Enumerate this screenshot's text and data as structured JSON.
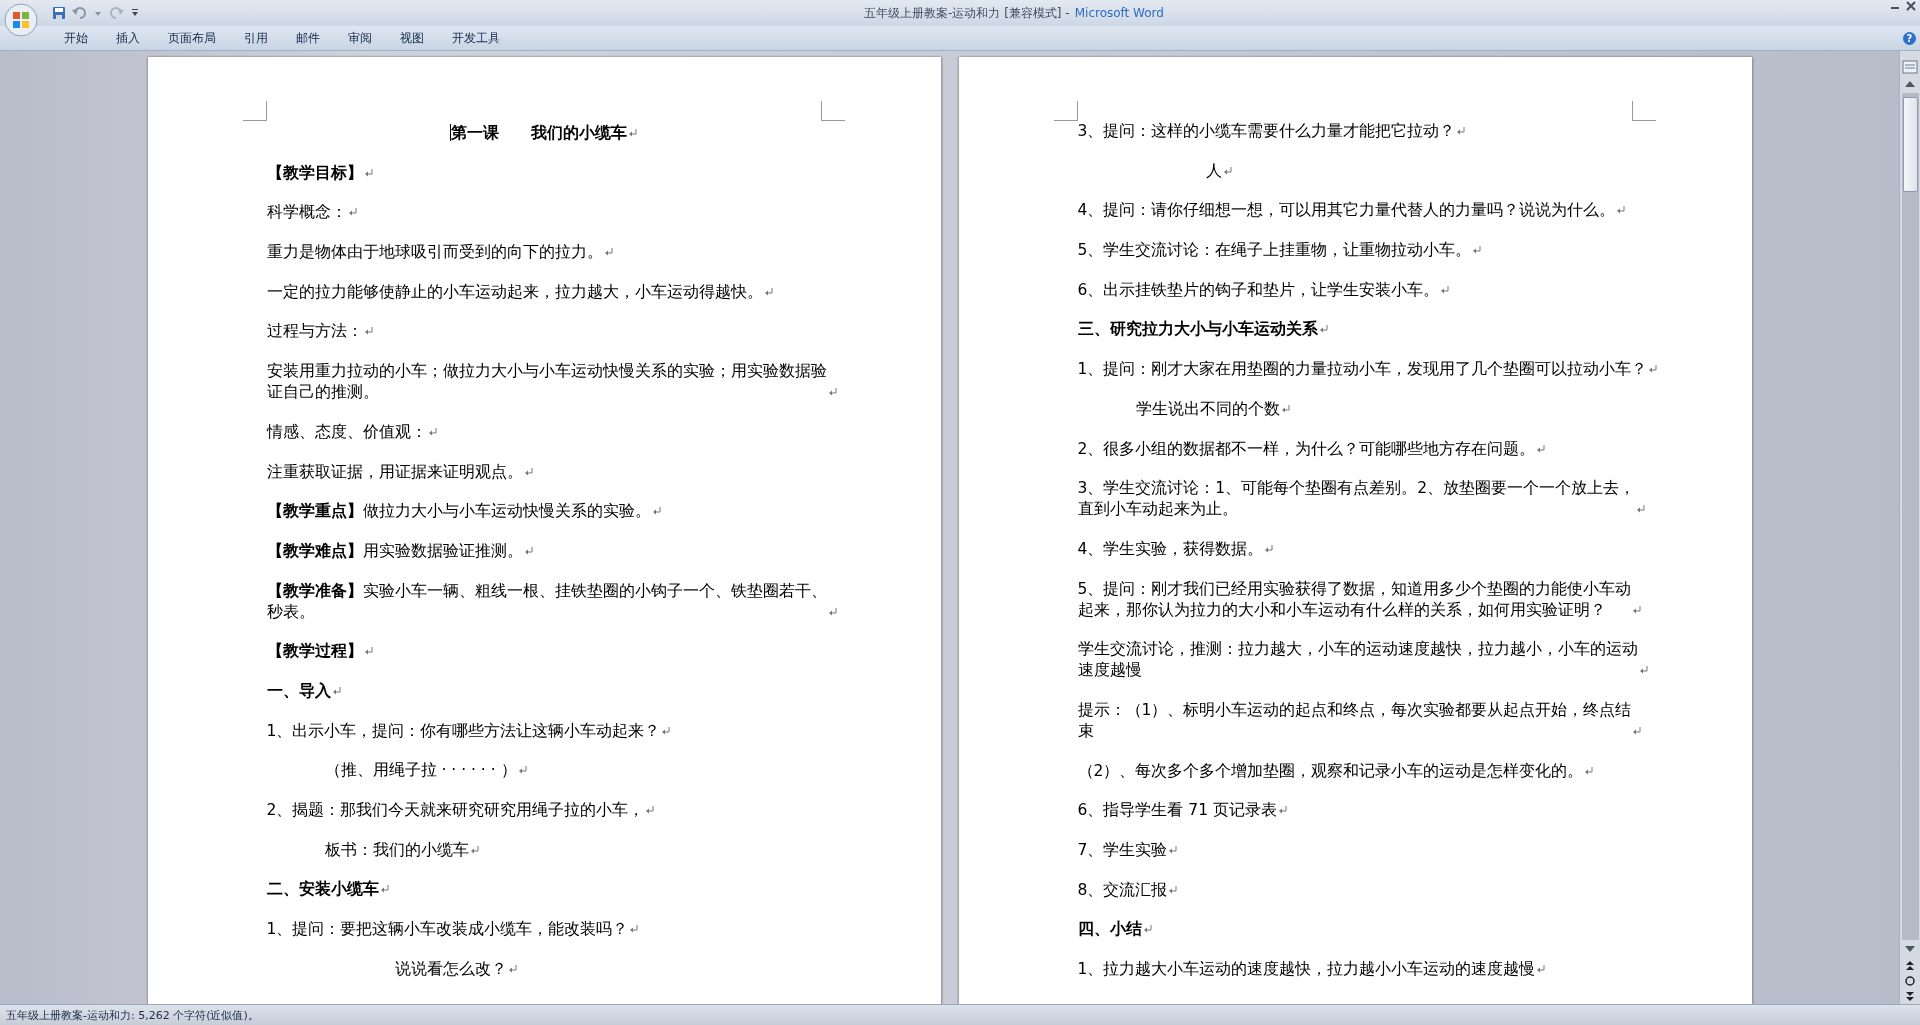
{
  "window": {
    "title": "五年级上册教案-运动和力 [兼容模式] -",
    "app": "Microsoft Word"
  },
  "ribbon_tabs": [
    "开始",
    "插入",
    "页面布局",
    "引用",
    "邮件",
    "审阅",
    "视图",
    "开发工具"
  ],
  "help_button": "?",
  "pages": [
    {
      "paragraphs": [
        {
          "kind": "title",
          "text": "第一课　　我们的小缆车",
          "cursor": true
        },
        {
          "kind": "heading",
          "text": "【教学目标】"
        },
        {
          "kind": "body",
          "text": "科学概念："
        },
        {
          "kind": "body",
          "text": "重力是物体由于地球吸引而受到的向下的拉力。"
        },
        {
          "kind": "body",
          "text": "一定的拉力能够使静止的小车运动起来，拉力越大，小车运动得越快。"
        },
        {
          "kind": "body",
          "text": "过程与方法："
        },
        {
          "kind": "body",
          "lines": [
            "安装用重力拉动的小车；做拉力大小与小车运动快慢关系的实验；用实验数据验",
            "证自己的推测。"
          ]
        },
        {
          "kind": "body",
          "text": "情感、态度、价值观："
        },
        {
          "kind": "body",
          "text": "注重获取证据，用证据来证明观点。"
        },
        {
          "kind": "body",
          "text": "**【教学重点】**做拉力大小与小车运动快慢关系的实验。"
        },
        {
          "kind": "body",
          "text": "**【教学难点】**用实验数据验证推测。"
        },
        {
          "kind": "body",
          "lines": [
            "**【教学准备】**实验小车一辆、粗线一根、挂铁垫圈的小钩子一个、铁垫圈若干、",
            "秒表。"
          ]
        },
        {
          "kind": "heading",
          "text": "【教学过程】"
        },
        {
          "kind": "heading",
          "text": "一、导入"
        },
        {
          "kind": "body",
          "text": "1、出示小车，提问：你有哪些方法让这辆小车动起来？"
        },
        {
          "kind": "inset",
          "text": "（推、用绳子拉 · · · · · · ）"
        },
        {
          "kind": "body",
          "text": "2、揭题：那我们今天就来研究研究用绳子拉的小车，"
        },
        {
          "kind": "inset",
          "text": "板书：我们的小缆车"
        },
        {
          "kind": "heading",
          "text": "二、安装小缆车"
        },
        {
          "kind": "body",
          "text": "1、提问：要把这辆小车改装成小缆车，能改装吗？"
        },
        {
          "kind": "deep",
          "text": "说说看怎么改？"
        }
      ]
    },
    {
      "paragraphs": [
        {
          "kind": "body",
          "text": "3、提问：这样的小缆车需要什么力量才能把它拉动？"
        },
        {
          "kind": "deep",
          "text": "人"
        },
        {
          "kind": "body",
          "text": "4、提问：请你仔细想一想，可以用其它力量代替人的力量吗？说说为什么。"
        },
        {
          "kind": "body",
          "text": "5、学生交流讨论：在绳子上挂重物，让重物拉动小车。"
        },
        {
          "kind": "body",
          "text": "6、出示挂铁垫片的钩子和垫片，让学生安装小车。"
        },
        {
          "kind": "heading",
          "text": "三、研究拉力大小与小车运动关系"
        },
        {
          "kind": "body",
          "text": "1、提问：刚才大家在用垫圈的力量拉动小车，发现用了几个垫圈可以拉动小车？"
        },
        {
          "kind": "inset",
          "text": "学生说出不同的个数"
        },
        {
          "kind": "body",
          "text": "2、很多小组的数据都不一样，为什么？可能哪些地方存在问题。"
        },
        {
          "kind": "body",
          "lines": [
            "3、学生交流讨论：1、可能每个垫圈有点差别。2、放垫圈要一个一个放上去，",
            "直到小车动起来为止。"
          ]
        },
        {
          "kind": "body",
          "text": "4、学生实验，获得数据。"
        },
        {
          "kind": "body",
          "lines": [
            "5、提问：刚才我们已经用实验获得了数据，知道用多少个垫圈的力能使小车动",
            "起来，那你认为拉力的大小和小车运动有什么样的关系，如何用实验证明？"
          ]
        },
        {
          "kind": "body",
          "lines": [
            "学生交流讨论，推测：拉力越大，小车的运动速度越快，拉力越小，小车的运动",
            "速度越慢"
          ]
        },
        {
          "kind": "body",
          "lines": [
            "提示：（1）、标明小车运动的起点和终点，每次实验都要从起点开始，终点结",
            "束"
          ]
        },
        {
          "kind": "body",
          "text": "（2）、每次多个多个增加垫圈，观察和记录小车的运动是怎样变化的。"
        },
        {
          "kind": "body",
          "text": "6、指导学生看 71 页记录表"
        },
        {
          "kind": "body",
          "text": "7、学生实验"
        },
        {
          "kind": "body",
          "text": "8、交流汇报"
        },
        {
          "kind": "heading",
          "text": "四、小结"
        },
        {
          "kind": "body",
          "text": "1、拉力越大小车运动的速度越快，拉力越小小车运动的速度越慢"
        }
      ]
    }
  ],
  "status_bar": "五年级上册教案-运动和力: 5,262 个字符(近似值)。"
}
